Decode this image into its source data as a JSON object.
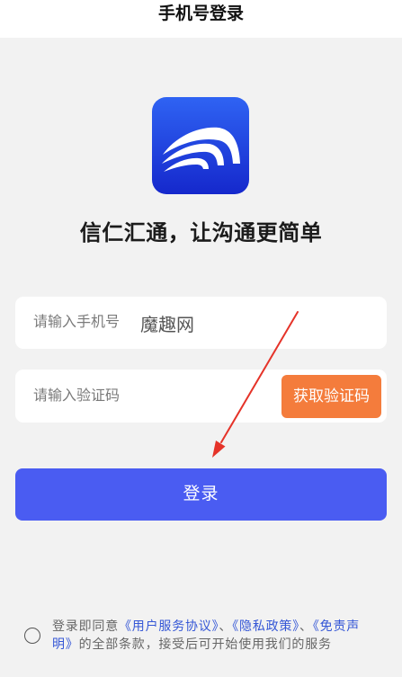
{
  "header": {
    "title": "手机号登录"
  },
  "logo": {
    "icon": "app-logo-wave-icon"
  },
  "slogan": "信仁汇通，让沟通更简单",
  "phone": {
    "placeholder": "请输入手机号",
    "value": "",
    "watermark": "魔趣网"
  },
  "code": {
    "placeholder": "请输入验证码",
    "value": "",
    "get_code_label": "获取验证码"
  },
  "login": {
    "label": "登录"
  },
  "agreement": {
    "checked": false,
    "prefix": "登录即同意",
    "link_user": "《用户服务协议》",
    "sep1": "、",
    "link_privacy": "《隐私政策》",
    "sep2": "、",
    "link_disclaimer": "《免责声明》",
    "suffix": "的全部条款，接受后可开始使用我们的服务"
  },
  "annotation": {
    "icon": "red-arrow-icon",
    "color": "#e53329"
  },
  "colors": {
    "background": "#f2f2f2",
    "accent": "#4a5cf2",
    "orange": "#f47c3c",
    "link": "#3557d6",
    "logo_top": "#2f63f3",
    "logo_bottom": "#1528cc"
  }
}
